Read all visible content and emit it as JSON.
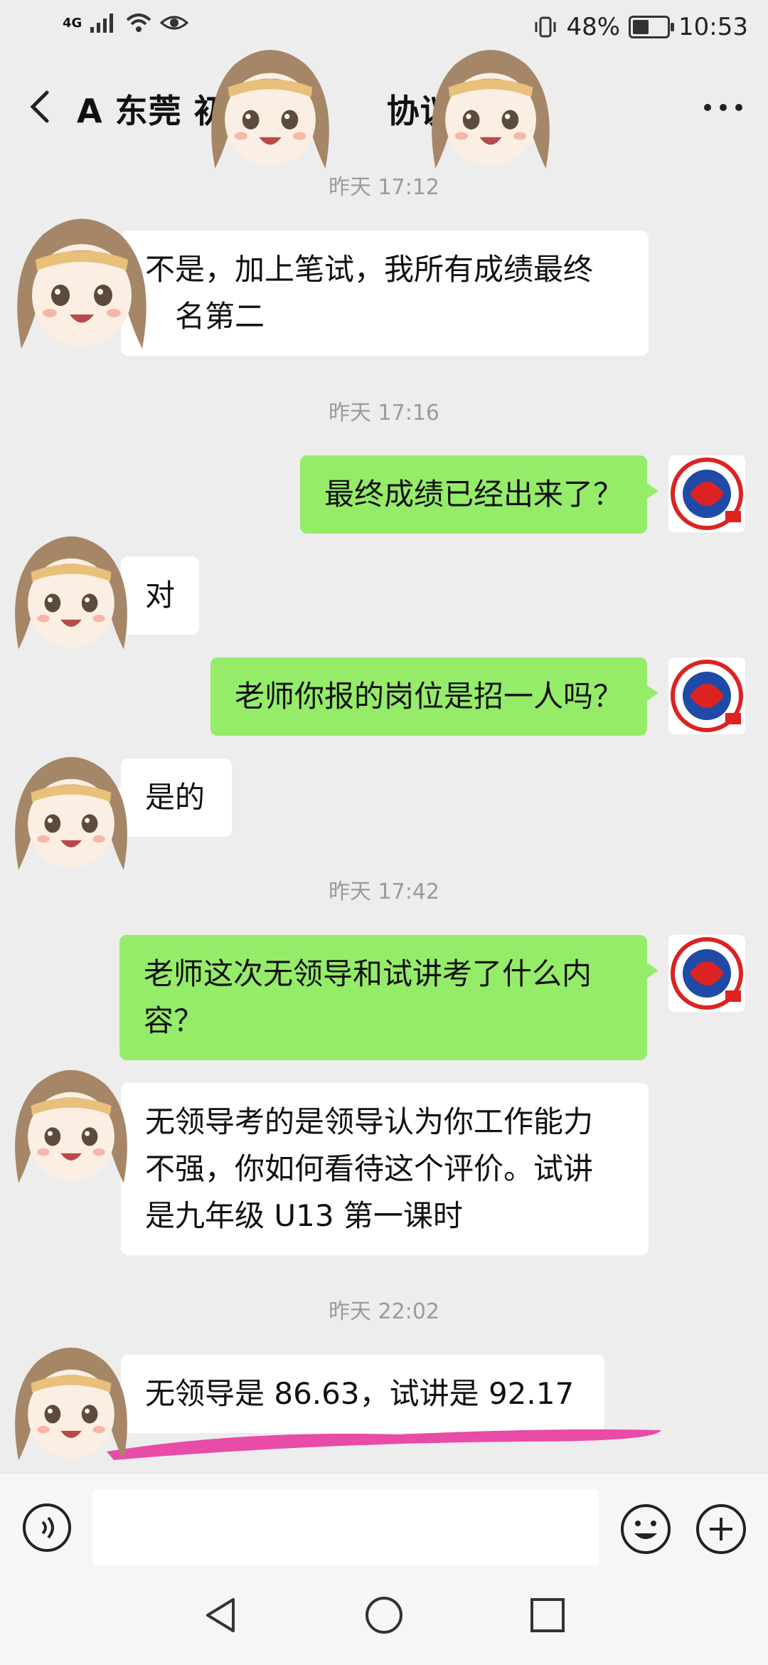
{
  "status_bar": {
    "network": "4G",
    "battery_percent": "48%",
    "battery_level": 0.48,
    "time": "10:53"
  },
  "header": {
    "title": "A 东莞 初",
    "title_tail": "协议",
    "more": "•••"
  },
  "messages": {
    "t1": "昨天 17:12",
    "m1": "不是，加上笔试，我所有成绩最终",
    "m1b": "名第二",
    "t2": "昨天 17:16",
    "m2": "最终成绩已经出来了？",
    "m3": "对",
    "m4": "老师你报的岗位是招一人吗？",
    "m5": "是的",
    "t3": "昨天 17:42",
    "m6a": "老师这次无领导和试讲考了什么内",
    "m6b": "容？",
    "m7a": "无领导考的是领导认为你工作能力",
    "m7b": "不强，你如何看待这个评价。试讲",
    "m7c": "是九年级 U13 第一课时",
    "t4": "昨天 22:02",
    "m8": "无领导是 86.63，试讲是 92.17"
  },
  "input": {
    "placeholder": ""
  },
  "colors": {
    "outgoing_bubble": "#95ec69",
    "incoming_bubble": "#ffffff",
    "background": "#ededed",
    "scribble": "#e84ba8"
  }
}
